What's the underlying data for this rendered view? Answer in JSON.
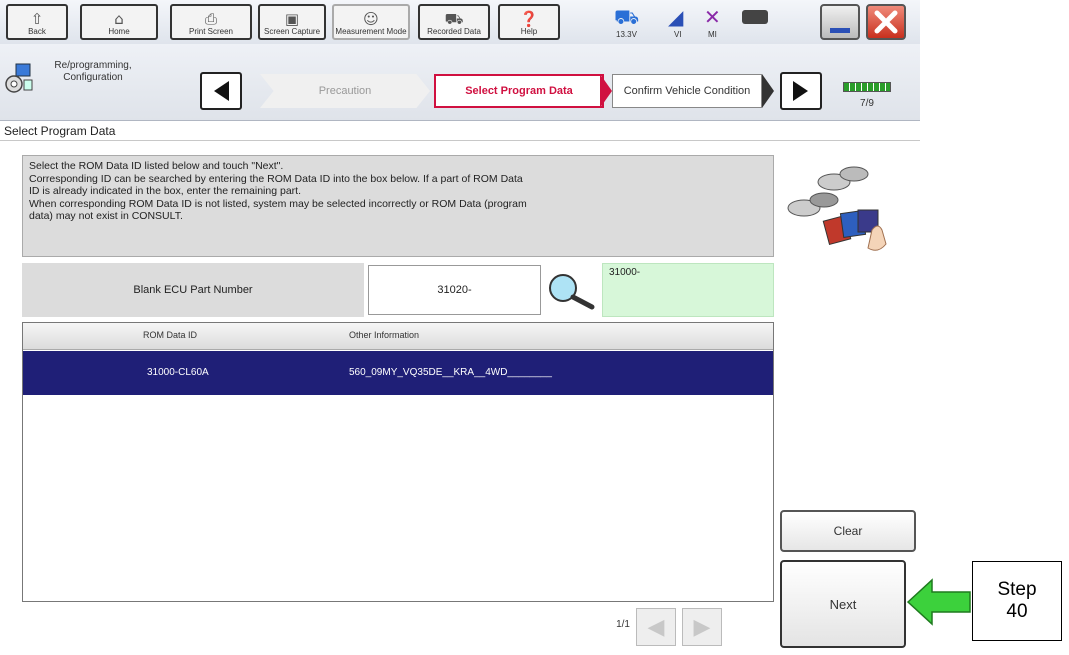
{
  "toolbar": {
    "buttons": [
      {
        "label": "Back",
        "icon": "home-arrow-icon"
      },
      {
        "label": "Home",
        "icon": "house-icon"
      },
      {
        "label": "Print Screen",
        "icon": "printer-icon"
      },
      {
        "label": "Screen Capture",
        "icon": "camera-icon"
      },
      {
        "label": "Measurement Mode",
        "icon": "person-icon"
      },
      {
        "label": "Recorded Data",
        "icon": "car-data-icon"
      },
      {
        "label": "Help",
        "icon": "help-icon"
      }
    ],
    "status": {
      "battery_label": "13.3V",
      "vi_label": "VI",
      "mi_label": "MI"
    }
  },
  "nav": {
    "wizard_title": "Re/programming, Configuration",
    "steps": {
      "previous": "Precaution",
      "current": "Select Program Data",
      "next": "Confirm Vehicle Condition"
    },
    "progress": "7/9"
  },
  "page": {
    "title": "Select Program Data",
    "instructions": [
      "Select the ROM Data ID listed below and touch \"Next\".",
      "Corresponding ID can be searched by entering the ROM Data ID into the box below. If a part of ROM Data",
      "ID is already indicated in the box, enter the remaining part.",
      "When corresponding ROM Data ID is not listed, system may be selected incorrectly or ROM Data (program",
      "data) may not exist in CONSULT."
    ]
  },
  "part_number": {
    "label": "Blank ECU Part Number",
    "value": "31020-",
    "search_value": "31000-"
  },
  "table": {
    "headers": [
      "ROM Data ID",
      "Other Information"
    ],
    "rows": [
      {
        "rom_id": "31000-CL60A",
        "info": "560_09MY_VQ35DE__KRA__4WD________"
      }
    ]
  },
  "paging": {
    "label": "1/1"
  },
  "buttons": {
    "clear": "Clear",
    "next": "Next"
  },
  "callout": {
    "line1": "Step",
    "line2": "40",
    "arrow_color": "#3cd13c"
  },
  "colors": {
    "selected_row": "#1f1f77",
    "current_step": "#d01040",
    "search_result_bg": "#d7f7d9"
  }
}
